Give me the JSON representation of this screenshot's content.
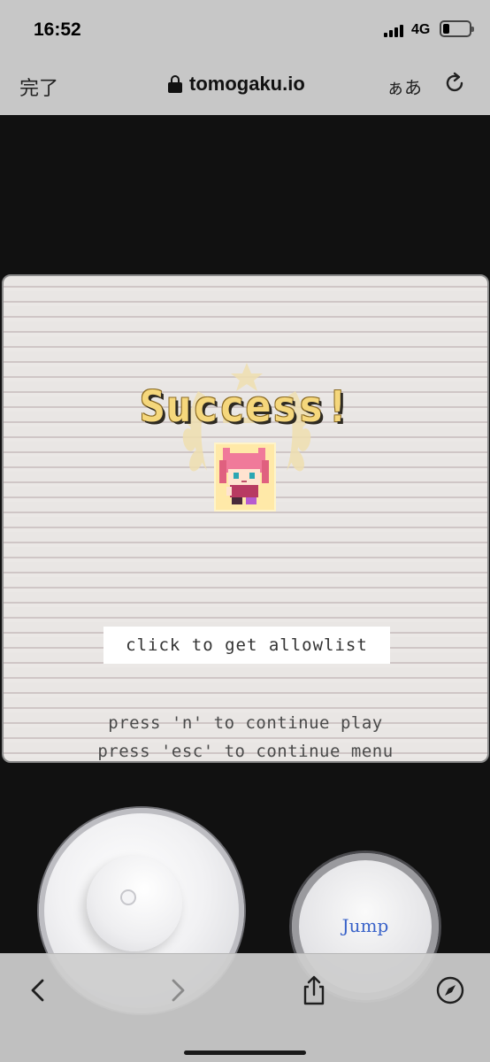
{
  "status_bar": {
    "time": "16:52",
    "network": "4G"
  },
  "browser": {
    "done_label": "完了",
    "url": "tomogaku.io",
    "text_size_label": "ぁあ",
    "icons": {
      "lock": "lock-icon",
      "reload": "reload-icon",
      "back": "chevron-left-icon",
      "forward": "chevron-right-icon",
      "share": "share-icon",
      "compass": "compass-icon"
    }
  },
  "game": {
    "title": "Success!",
    "allowlist_button": "click to get allowlist",
    "hint_continue": "press 'n' to continue play",
    "hint_menu": "press 'esc' to continue menu",
    "colors": {
      "title": "#f5d77c",
      "panel_bg": "#e8e4e2",
      "laurel": "#efdfb0",
      "avatar_hair": "#f07a9a"
    }
  },
  "controls": {
    "jump_label": "Jump",
    "jump_color": "#3a63c9"
  }
}
